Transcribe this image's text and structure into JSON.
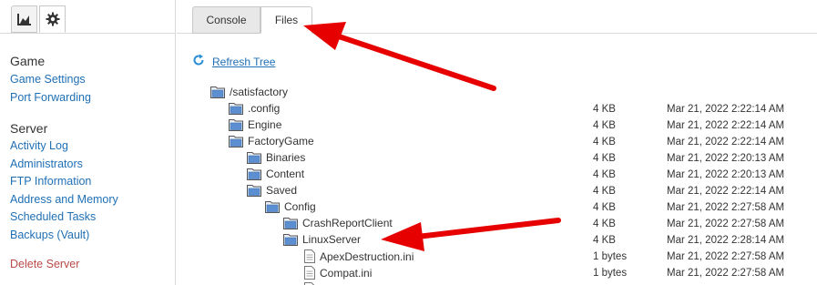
{
  "sidebar": {
    "icons": [
      "chart-icon",
      "gear-icon"
    ],
    "sections": [
      {
        "title": "Game",
        "items": [
          "Game Settings",
          "Port Forwarding"
        ]
      },
      {
        "title": "Server",
        "items": [
          "Activity Log",
          "Administrators",
          "FTP Information",
          "Address and Memory",
          "Scheduled Tasks",
          "Backups (Vault)"
        ]
      }
    ],
    "delete_label": "Delete Server"
  },
  "tabs": [
    {
      "label": "Console",
      "active": false
    },
    {
      "label": "Files",
      "active": true
    }
  ],
  "refresh_label": "Refresh Tree",
  "tree": [
    {
      "name": "/satisfactory",
      "type": "folder",
      "level": 0,
      "size": "",
      "date": ""
    },
    {
      "name": ".config",
      "type": "folder",
      "level": 1,
      "size": "4 KB",
      "date": "Mar 21, 2022 2:22:14 AM"
    },
    {
      "name": "Engine",
      "type": "folder",
      "level": 1,
      "size": "4 KB",
      "date": "Mar 21, 2022 2:22:14 AM"
    },
    {
      "name": "FactoryGame",
      "type": "folder",
      "level": 1,
      "size": "4 KB",
      "date": "Mar 21, 2022 2:22:14 AM"
    },
    {
      "name": "Binaries",
      "type": "folder",
      "level": 2,
      "size": "4 KB",
      "date": "Mar 21, 2022 2:20:13 AM"
    },
    {
      "name": "Content",
      "type": "folder",
      "level": 2,
      "size": "4 KB",
      "date": "Mar 21, 2022 2:20:13 AM"
    },
    {
      "name": "Saved",
      "type": "folder",
      "level": 2,
      "size": "4 KB",
      "date": "Mar 21, 2022 2:22:14 AM"
    },
    {
      "name": "Config",
      "type": "folder",
      "level": 3,
      "size": "4 KB",
      "date": "Mar 21, 2022 2:27:58 AM"
    },
    {
      "name": "CrashReportClient",
      "type": "folder",
      "level": 4,
      "size": "4 KB",
      "date": "Mar 21, 2022 2:27:58 AM"
    },
    {
      "name": "LinuxServer",
      "type": "folder",
      "level": 4,
      "size": "4 KB",
      "date": "Mar 21, 2022 2:28:14 AM"
    },
    {
      "name": "ApexDestruction.ini",
      "type": "file",
      "level": 5,
      "size": "1 bytes",
      "date": "Mar 21, 2022 2:27:58 AM"
    },
    {
      "name": "Compat.ini",
      "type": "file",
      "level": 5,
      "size": "1 bytes",
      "date": "Mar 21, 2022 2:27:58 AM"
    },
    {
      "name": "",
      "type": "file",
      "level": 5,
      "size": "",
      "date": ""
    }
  ],
  "annotations": [
    "arrow-to-files-tab",
    "arrow-to-linuxserver-folder"
  ],
  "colors": {
    "link": "#1f6fb5",
    "danger": "#b94a48",
    "arrow": "#e60000",
    "folder": "#5b8fd1"
  }
}
